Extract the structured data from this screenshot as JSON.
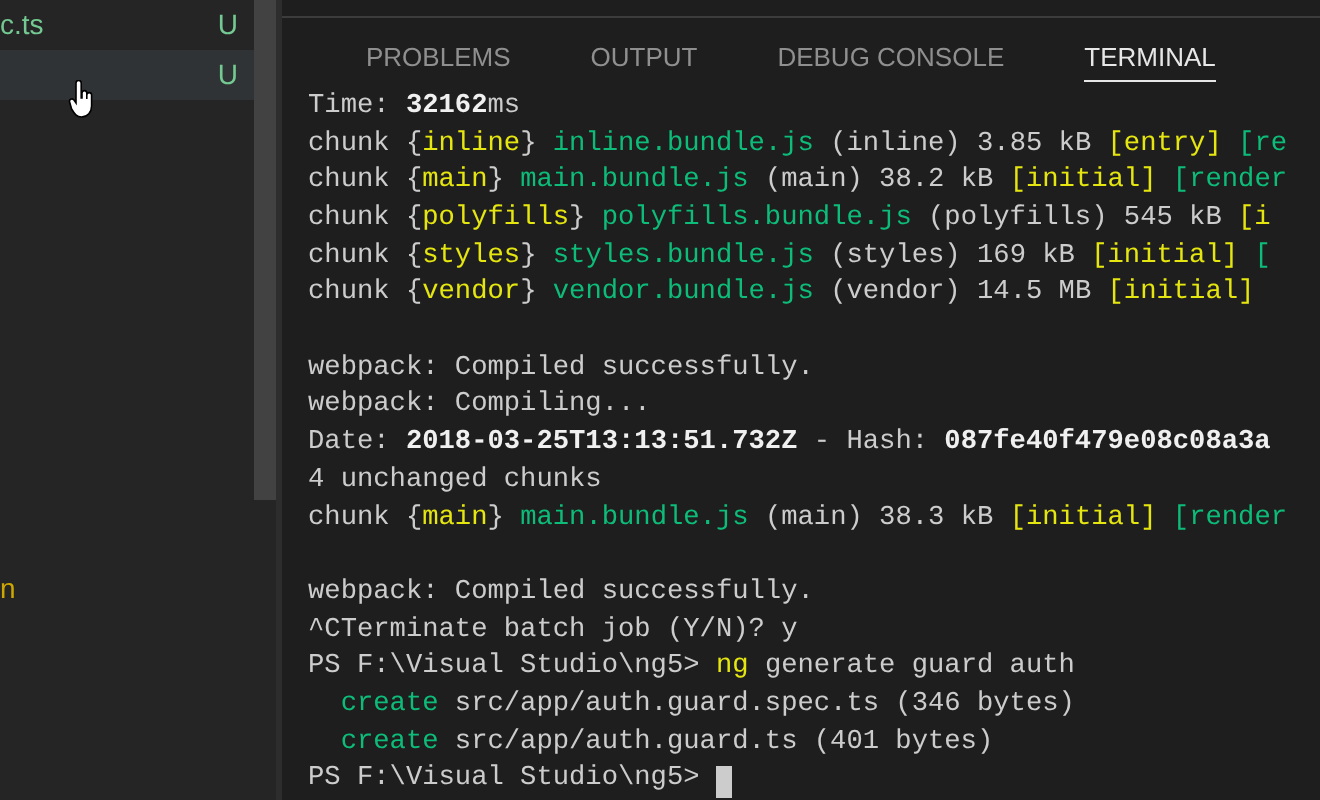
{
  "sidebar": {
    "items": [
      {
        "label": "c.ts",
        "status": "U",
        "selected": false
      },
      {
        "status": "U",
        "selected": true
      }
    ],
    "fragment": "n"
  },
  "tabs": [
    {
      "label": "PROBLEMS",
      "selected": false
    },
    {
      "label": "OUTPUT",
      "selected": false
    },
    {
      "label": "DEBUG CONSOLE",
      "selected": false
    },
    {
      "label": "TERMINAL",
      "selected": true
    }
  ],
  "terminal": {
    "blocks": [
      [
        [
          {
            "kind": "plain",
            "text": "Time: "
          },
          {
            "kind": "bold",
            "text": "32162"
          },
          {
            "kind": "plain",
            "text": "ms"
          }
        ],
        [
          {
            "kind": "plain",
            "text": "chunk {"
          },
          {
            "kind": "yellow",
            "text": "inline"
          },
          {
            "kind": "plain",
            "text": "} "
          },
          {
            "kind": "green",
            "text": "inline.bundle.js"
          },
          {
            "kind": "plain",
            "text": " (inline) 3.85 kB "
          },
          {
            "kind": "yellow",
            "text": "[entry]"
          },
          {
            "kind": "green",
            "text": " [re"
          }
        ],
        [
          {
            "kind": "plain",
            "text": "chunk {"
          },
          {
            "kind": "yellow",
            "text": "main"
          },
          {
            "kind": "plain",
            "text": "} "
          },
          {
            "kind": "green",
            "text": "main.bundle.js"
          },
          {
            "kind": "plain",
            "text": " (main) 38.2 kB "
          },
          {
            "kind": "yellow",
            "text": "[initial]"
          },
          {
            "kind": "green",
            "text": " [render"
          }
        ],
        [
          {
            "kind": "plain",
            "text": "chunk {"
          },
          {
            "kind": "yellow",
            "text": "polyfills"
          },
          {
            "kind": "plain",
            "text": "} "
          },
          {
            "kind": "green",
            "text": "polyfills.bundle.js"
          },
          {
            "kind": "plain",
            "text": " (polyfills) 545 kB "
          },
          {
            "kind": "yellow",
            "text": "[i"
          }
        ],
        [
          {
            "kind": "plain",
            "text": "chunk {"
          },
          {
            "kind": "yellow",
            "text": "styles"
          },
          {
            "kind": "plain",
            "text": "} "
          },
          {
            "kind": "green",
            "text": "styles.bundle.js"
          },
          {
            "kind": "plain",
            "text": " (styles) 169 kB "
          },
          {
            "kind": "yellow",
            "text": "[initial]"
          },
          {
            "kind": "green",
            "text": " ["
          }
        ],
        [
          {
            "kind": "plain",
            "text": "chunk {"
          },
          {
            "kind": "yellow",
            "text": "vendor"
          },
          {
            "kind": "plain",
            "text": "} "
          },
          {
            "kind": "green",
            "text": "vendor.bundle.js"
          },
          {
            "kind": "plain",
            "text": " (vendor) 14.5 MB "
          },
          {
            "kind": "yellow",
            "text": "[initial]"
          }
        ]
      ],
      [
        [
          {
            "kind": "plain",
            "text": "webpack: Compiled successfully."
          }
        ],
        [
          {
            "kind": "plain",
            "text": "webpack: Compiling..."
          }
        ],
        [
          {
            "kind": "plain",
            "text": "Date: "
          },
          {
            "kind": "bold",
            "text": "2018-03-25T13:13:51.732Z"
          },
          {
            "kind": "plain",
            "text": " - Hash: "
          },
          {
            "kind": "bold",
            "text": "087fe40f479e08c08a3a"
          }
        ],
        [
          {
            "kind": "plain",
            "text": "4 unchanged chunks"
          }
        ],
        [
          {
            "kind": "plain",
            "text": "chunk {"
          },
          {
            "kind": "yellow",
            "text": "main"
          },
          {
            "kind": "plain",
            "text": "} "
          },
          {
            "kind": "green",
            "text": "main.bundle.js"
          },
          {
            "kind": "plain",
            "text": " (main) 38.3 kB "
          },
          {
            "kind": "yellow",
            "text": "[initial]"
          },
          {
            "kind": "green",
            "text": " [render"
          }
        ]
      ],
      [
        [
          {
            "kind": "plain",
            "text": "webpack: Compiled successfully."
          }
        ],
        [
          {
            "kind": "plain",
            "text": "^CTerminate batch job (Y/N)? y"
          }
        ],
        [
          {
            "kind": "plain",
            "text": "PS F:\\Visual Studio\\ng5> "
          },
          {
            "kind": "yellow",
            "text": "ng"
          },
          {
            "kind": "plain",
            "text": " generate guard auth"
          }
        ],
        [
          {
            "kind": "green",
            "text": "  create"
          },
          {
            "kind": "plain",
            "text": " src/app/auth.guard.spec.ts (346 bytes)"
          }
        ],
        [
          {
            "kind": "green",
            "text": "  create"
          },
          {
            "kind": "plain",
            "text": " src/app/auth.guard.ts (401 bytes)"
          }
        ],
        [
          {
            "kind": "plain",
            "text": "PS F:\\Visual Studio\\ng5> "
          }
        ]
      ]
    ],
    "cursor": true
  }
}
